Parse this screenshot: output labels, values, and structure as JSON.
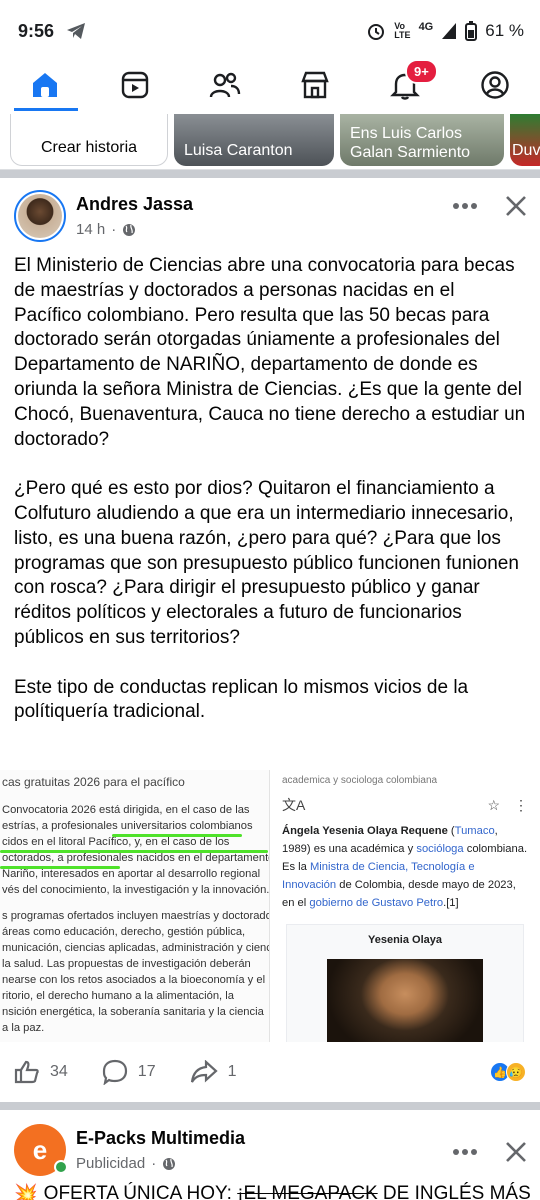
{
  "status_bar": {
    "time": "9:56",
    "network": "Vo\nLTE",
    "signal_label": "4G",
    "battery": "61 %"
  },
  "nav": {
    "tabs": [
      "home-icon",
      "video-icon",
      "friends-icon",
      "marketplace-icon",
      "notifications-icon",
      "profile-icon"
    ],
    "notification_badge": "9+",
    "accent": "#1877f2"
  },
  "stories": {
    "create_label": "Crear historia",
    "items": [
      {
        "name": "Luisa Caranton"
      },
      {
        "name": "Ens Luis Carlos\nGalan Sarmiento"
      },
      {
        "name": "Duv"
      }
    ]
  },
  "post": {
    "author": "Andres Jassa",
    "time": "14 h",
    "paragraphs": [
      "El Ministerio de Ciencias abre una convocatoria para becas de maestrías y doctorados a personas nacidas en el Pacífico colombiano. Pero resulta que las 50 becas para doctorado serán otorgadas úniamente a profesionales del Departamento de NARIÑO, departamento de donde es oriunda la señora Ministra de Ciencias. ¿Es que la gente del Chocó, Buenaventura, Cauca no tiene derecho a estudiar un doctorado?",
      "¿Pero qué es esto por dios? Quitaron el financiamiento a Colfuturo aludiendo a que era un intermediario innecesario, listo, es una buena razón, ¿pero para qué? ¿Para que los programas que son presupuesto público funcionen  funionen con rosca?  ¿Para dirigir el presupuesto público y ganar réditos políticos y electorales a futuro de funcionarios públicos en sus territorios?",
      "Este tipo de conductas replican lo mismos vicios de la polítiquería tradicional."
    ],
    "image_left": {
      "title": "cas gratuitas 2026 para el pacífico",
      "lines": [
        "Convocatoria 2026 está dirigida, en el caso de las",
        "estrías, a profesionales  universitarios colombianos",
        "cidos en el litoral Pacífico, y, en el caso de los",
        "octorados, a  profesionales nacidos en el departamento",
        "Nariño, interesados en aportar al desarrollo  regional",
        "vés del conocimiento, la investigación y la innovación.",
        "s programas ofertados incluyen maestrías y doctorado",
        "áreas como educación,  derecho, gestión pública,",
        "municación, ciencias aplicadas, administración y cienci",
        "la  salud. Las propuestas de investigación deberán",
        "nearse con los retos asociados a la  bioeconomía y el",
        "ritorio, el derecho humano a la alimentación, la",
        "nsición energética, la  soberanía sanitaria y la ciencia",
        "a la paz."
      ]
    },
    "image_right": {
      "top_sub": "academica y sociologa colombiana",
      "bio_name": "Ángela Yesenia Olaya Requene",
      "bio_open": " (",
      "bio_place": "Tumaco",
      "bio_year": ", 1989) es una académica y ",
      "bio_role": "socióloga",
      "bio_mid": " colombiana. Es la ",
      "bio_ministry": "Ministra de Ciencia, Tecnología e Innovación",
      "bio_tail": " de Colombia, desde mayo de 2023, en el ",
      "bio_gov": "gobierno de Gustavo Petro",
      "bio_ref": ".[1]",
      "infobox_title": "Yesenia Olaya"
    },
    "likes": "34",
    "comments": "17",
    "shares": "1"
  },
  "next_post": {
    "author": "E-Packs Multimedia",
    "label": "Publicidad",
    "promo_prefix": "OFERTA ÚNICA HOY: ",
    "promo_struck": "¡EL MEGAPACK",
    "promo_suffix": " DE INGLÉS MÁS"
  }
}
